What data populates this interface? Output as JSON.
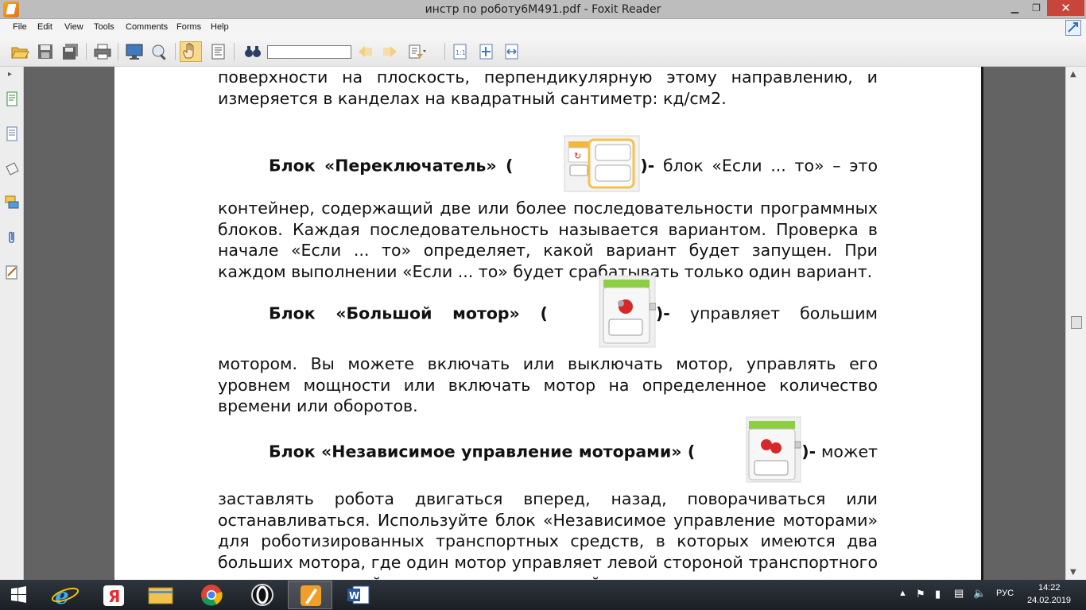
{
  "window": {
    "title": "инстр по роботу6М491.pdf - Foxit Reader",
    "controls": {
      "minimize": "▁",
      "maximize": "❐",
      "close": "✕"
    }
  },
  "menu": {
    "items": [
      "File",
      "Edit",
      "View",
      "Tools",
      "Comments",
      "Forms",
      "Help"
    ]
  },
  "toolbar": {
    "buttons": [
      "open-folder-icon",
      "save-icon",
      "save-all-icon",
      "print-icon",
      "screen-icon",
      "scan-icon",
      "hand-tool-icon",
      "select-text-icon",
      "find-binoculars-icon",
      "find-prev-icon",
      "find-next-icon",
      "bookmark-dropdown-icon",
      "actual-size-icon",
      "fit-page-icon",
      "fit-width-icon"
    ],
    "find_value": ""
  },
  "sidebar": {
    "icons": [
      "pages-icon",
      "layers-icon",
      "bookmarks-icon",
      "comments-icon",
      "attachments-icon",
      "signature-icon"
    ]
  },
  "document": {
    "p1": "поверхности на плоскость, перпендикулярную этому направлению, и измеряется в канделах на квадратный сантиметр: кд/см2.",
    "p2_bold": "Блок «Переключатель» (",
    "p2_bold_end": ")-",
    "p2": " блок «Если ... то» – это контейнер, содержащий две или более последовательности программных блоков. Каждая последовательность называется вариантом. Проверка в начале «Если ... то» определяет, какой вариант будет запущен. При каждом выполнении «Если ... то» будет срабатывать только один вариант.",
    "p3_bold": "Блок «Большой мотор» (",
    "p3_bold_end": ")-",
    "p3": " управляет большим мотором. Вы можете включать или выключать мотор, управлять его уровнем мощности или включать мотор на определенное количество времени или оборотов.",
    "p4_bold": "Блок «Независимое управление моторами» (",
    "p4_bold_end": ")-",
    "p4": " может заставлять робота двигаться вперед, назад, поворачиваться или останавливаться. Используйте блок «Независимое управление моторами» для роботизированных транспортных средств, в которых имеются два больших мотора, где один мотор управляет левой стороной транспортного средства, а второй мотор управляет правой"
  },
  "taskbar": {
    "apps": [
      "windows-start-icon",
      "internet-explorer-icon",
      "yandex-browser-icon",
      "file-explorer-icon",
      "chrome-icon",
      "opera-icon",
      "foxit-reader-icon",
      "word-icon"
    ],
    "active_app": "foxit-reader-icon",
    "tray": {
      "language": "РУС",
      "time": "14:22",
      "date": "24.02.2019"
    }
  }
}
